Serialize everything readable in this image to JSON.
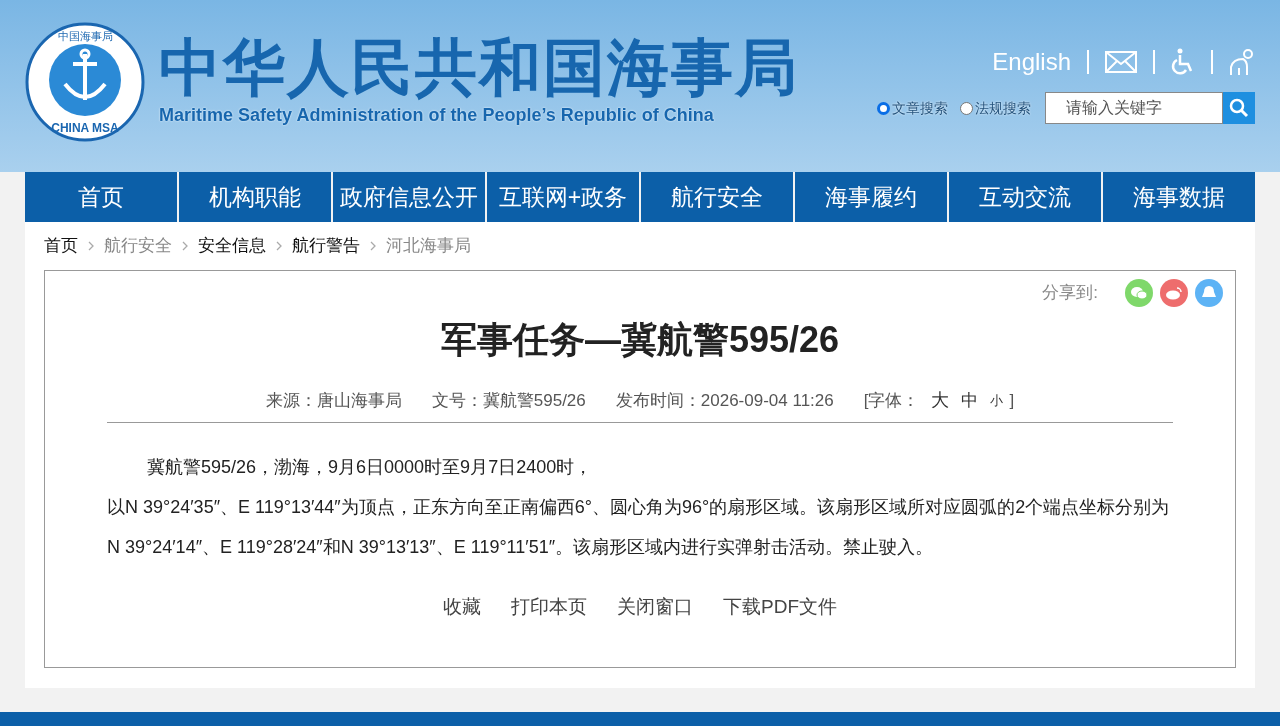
{
  "header": {
    "logo": {
      "top_text": "中国海事局",
      "bottom_text": "CHINA MSA"
    },
    "title": "中华人民共和国海事局",
    "subtitle": "Maritime Safety Administration of the People’s Republic of China",
    "language_link": "English",
    "search_scopes": [
      {
        "label": "文章搜索",
        "selected": true
      },
      {
        "label": "法规搜索",
        "selected": false
      }
    ],
    "search": {
      "placeholder": "请输入关键字"
    }
  },
  "nav": [
    "首页",
    "机构职能",
    "政府信息公开",
    "互联网+政务",
    "航行安全",
    "海事履约",
    "互动交流",
    "海事数据"
  ],
  "breadcrumb": [
    {
      "label": "首页",
      "dimmed": false
    },
    {
      "label": "航行安全",
      "dimmed": true
    },
    {
      "label": "安全信息",
      "dimmed": false
    },
    {
      "label": "航行警告",
      "dimmed": false
    },
    {
      "label": "河北海事局",
      "dimmed": true
    }
  ],
  "share": {
    "label": "分享到:"
  },
  "article": {
    "title": "军事任务—冀航警595/26",
    "meta": [
      "来源：唐山海事局",
      "文号：冀航警595/26",
      "发布时间：2026-09-04 11:26"
    ],
    "font_label": "[字体：",
    "font_sizes": [
      {
        "label": "大",
        "kind": "large"
      },
      {
        "label": "中",
        "kind": "medium"
      },
      {
        "label": "小",
        "kind": "small"
      }
    ],
    "font_close": "]",
    "paragraphs": [
      {
        "text": "冀航警595/26，渤海，9月6日0000时至9月7日2400时，",
        "indented": true
      },
      {
        "text": "以N 39°24′35″、E 119°13′44″为顶点，正东方向至正南偏西6°、圆心角为96°的扇形区域。该扇形区域所对应圆弧的2个端点坐标分别为N 39°24′14″、E 119°28′24″和N 39°13′13″、E 119°11′51″。该扇形区域内进行实弹射击活动。禁止驶入。",
        "indented": false
      }
    ],
    "actions": [
      "收藏",
      "打印本页",
      "关闭窗口",
      "下载PDF文件"
    ]
  }
}
